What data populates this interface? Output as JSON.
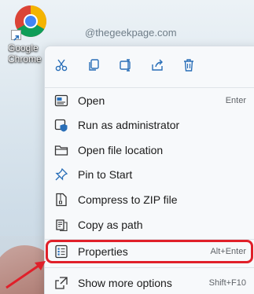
{
  "desktop": {
    "shortcut_label": "Google\nChrome",
    "watermark": "@thegeekpage.com"
  },
  "toolbar": {
    "buttons": [
      {
        "icon": "cut-icon"
      },
      {
        "icon": "copy-icon"
      },
      {
        "icon": "rename-icon"
      },
      {
        "icon": "share-icon"
      },
      {
        "icon": "delete-icon"
      }
    ]
  },
  "menu": {
    "items": [
      {
        "label": "Open",
        "shortcut": "Enter",
        "icon": "open-icon"
      },
      {
        "label": "Run as administrator",
        "shortcut": "",
        "icon": "shield-icon"
      },
      {
        "label": "Open file location",
        "shortcut": "",
        "icon": "folder-icon"
      },
      {
        "label": "Pin to Start",
        "shortcut": "",
        "icon": "pin-icon"
      },
      {
        "label": "Compress to ZIP file",
        "shortcut": "",
        "icon": "zip-icon"
      },
      {
        "label": "Copy as path",
        "shortcut": "",
        "icon": "copy-path-icon"
      },
      {
        "label": "Properties",
        "shortcut": "Alt+Enter",
        "icon": "properties-icon"
      },
      {
        "label": "Show more options",
        "shortcut": "Shift+F10",
        "icon": "more-options-icon"
      }
    ]
  },
  "colors": {
    "highlight": "#e0202a",
    "icon_blue": "#2a6fb8"
  }
}
